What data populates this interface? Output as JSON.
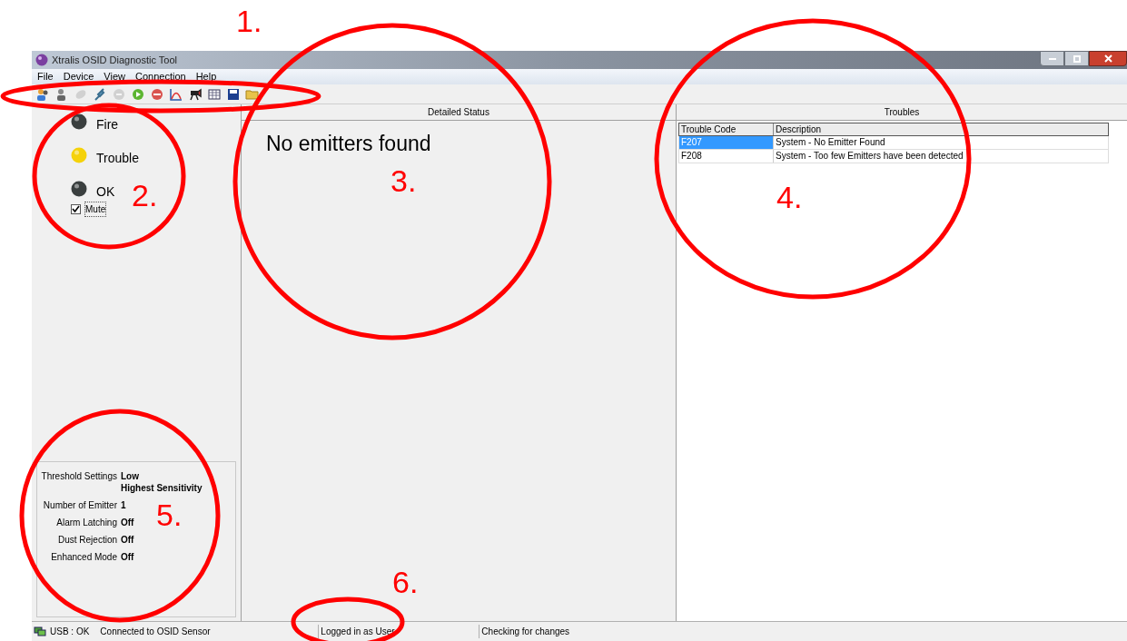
{
  "window": {
    "title": "Xtralis OSID Diagnostic Tool"
  },
  "menu": [
    "File",
    "Device",
    "View",
    "Connection",
    "Help"
  ],
  "toolbar": [
    {
      "kind": "users",
      "disabled": false
    },
    {
      "kind": "user",
      "disabled": false
    },
    {
      "kind": "leaf",
      "disabled": true
    },
    {
      "kind": "plug",
      "disabled": false
    },
    {
      "kind": "minus",
      "disabled": true
    },
    {
      "kind": "go",
      "disabled": false
    },
    {
      "kind": "stop",
      "disabled": false
    },
    {
      "kind": "chart",
      "disabled": false
    },
    {
      "kind": "camera",
      "disabled": false
    },
    {
      "kind": "table",
      "disabled": false
    },
    {
      "kind": "save",
      "disabled": false
    },
    {
      "kind": "folder",
      "disabled": false
    }
  ],
  "indicators": [
    {
      "label": "Fire",
      "color": "#3a3f3f"
    },
    {
      "label": "Trouble",
      "color": "#f5d20a"
    },
    {
      "label": "OK",
      "color": "#3a3f3f"
    }
  ],
  "mute": {
    "label": "Mute",
    "checked": true
  },
  "settings": [
    {
      "label": "Threshold Settings",
      "value": "Low",
      "value_2": "Highest Sensitivity"
    },
    {
      "label": "Number of Emitter",
      "value": "1"
    },
    {
      "label": "Alarm Latching",
      "value": "Off"
    },
    {
      "label": "Dust Rejection",
      "value": "Off"
    },
    {
      "label": "Enhanced Mode",
      "value": "Off"
    }
  ],
  "detailed_status": {
    "title": "Detailed Status",
    "message": "No emitters found"
  },
  "troubles": {
    "title": "Troubles",
    "columns": [
      "Trouble Code",
      "Description"
    ],
    "rows": [
      {
        "code": "F207",
        "description": "System - No Emitter Found",
        "selected": true
      },
      {
        "code": "F208",
        "description": "System - Too few Emitters have been detected",
        "selected": false
      }
    ]
  },
  "status_bar": {
    "connection": "USB : OK",
    "sensor": "Connected to OSID Sensor",
    "login": "Logged in as User",
    "activity": "Checking for changes"
  },
  "annotations": [
    {
      "number": "1."
    },
    {
      "number": "2."
    },
    {
      "number": "3."
    },
    {
      "number": "4."
    },
    {
      "number": "5."
    },
    {
      "number": "6."
    }
  ]
}
